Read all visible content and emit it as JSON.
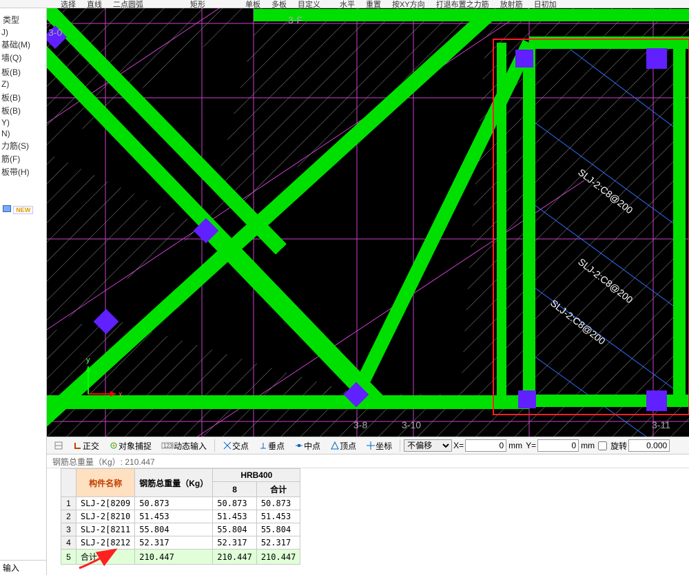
{
  "toolbar_top": {
    "items": [
      "选择",
      "直线",
      "二点圆弧",
      "矩形",
      "单板",
      "多板",
      "目定义",
      "水平",
      "重置",
      "按XY方向",
      "打退布置之力筋",
      "放射筋",
      "日初加"
    ]
  },
  "sidebar": {
    "title": "类型",
    "items": [
      "J)",
      "基础(M)",
      "墙(Q)",
      "",
      "板(B)",
      "Z)",
      "",
      "板(B)",
      "板(B)",
      "Y)",
      "N)",
      "力筋(S)",
      "筋(F)",
      "板带(H)"
    ],
    "new_label": "NEW",
    "bottom_label": "输入"
  },
  "canvas": {
    "grid_labels": [
      "3-F",
      "3-8",
      "3-10",
      "3-11",
      "3-0"
    ],
    "slab_text1": "SLJ-2:C8@200",
    "slab_text2": "SLJ-2:C8@200",
    "slab_text3": "SLJ-2:C8@200",
    "axis_x": "x",
    "axis_y": "y"
  },
  "options": {
    "ortho": "正交",
    "snap": "对象捕捉",
    "dyn_input": "动态输入",
    "intersection": "交点",
    "perpendicular": "垂点",
    "midpoint": "中点",
    "vertex": "顶点",
    "center": "坐标",
    "no_offset": "不偏移",
    "x_label": "X=",
    "y_label": "Y=",
    "unit": "mm",
    "rotate_label": "旋转",
    "x_value": "0",
    "y_value": "0",
    "rotate_value": "0.000"
  },
  "summary": {
    "label": "钢筋总重量（Kg）: 210.447"
  },
  "table": {
    "headers": {
      "name": "构件名称",
      "total": "钢筋总重量（Kg）",
      "group": "HRB400",
      "diameter": "8",
      "subtotal": "合计"
    },
    "rows": [
      {
        "n": "1",
        "name": "SLJ-2[8209",
        "w": "50.873",
        "d8": "50.873",
        "sub": "50.873"
      },
      {
        "n": "2",
        "name": "SLJ-2[8210",
        "w": "51.453",
        "d8": "51.453",
        "sub": "51.453"
      },
      {
        "n": "3",
        "name": "SLJ-2[8211",
        "w": "55.804",
        "d8": "55.804",
        "sub": "55.804"
      },
      {
        "n": "4",
        "name": "SLJ-2[8212",
        "w": "52.317",
        "d8": "52.317",
        "sub": "52.317"
      },
      {
        "n": "5",
        "name": "合计",
        "w": "210.447",
        "d8": "210.447",
        "sub": "210.447"
      }
    ]
  }
}
